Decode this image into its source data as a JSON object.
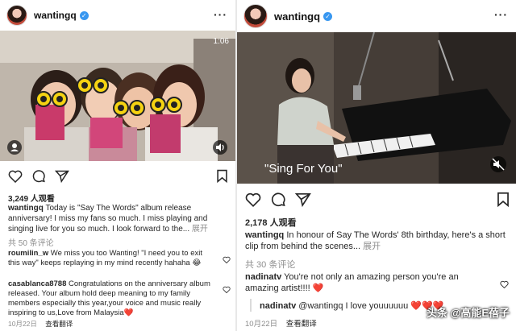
{
  "left": {
    "username": "wantingq",
    "video_time": "1:06",
    "views": "3,249 人观看",
    "caption_user": "wantingq",
    "caption_text": "Today is \"Say The Words\" album release anniversary! I miss my fans so much. I miss playing and singing live for you so much. I look forward to the...",
    "caption_more": "展开",
    "comments_total": "共 50 条评论",
    "comments": [
      {
        "user": "roumilin_w",
        "text": "We miss you too Wanting! \"I need you to exit this way\" keeps replaying in my mind recently hahaha 😂"
      },
      {
        "user": "casablanca8788",
        "text": "Congratulations on the anniversary album released. Your album hold deep meaning to my family members especially this year,your voice and music really inspiring to us,Love from Malaysia❤️"
      }
    ],
    "date": "10月22日",
    "translate": "查看翻译"
  },
  "right": {
    "username": "wantingq",
    "subtitle": "\"Sing For You\"",
    "views": "2,178 人观看",
    "caption_user": "wantingq",
    "caption_text": "In honour of Say The Words' 8th birthday, here's a short clip from behind the scenes...",
    "caption_more": "展开",
    "comments_total": "共 30 条评论",
    "comments": [
      {
        "user": "nadinatv",
        "text": "You're not only an amazing person you're an amazing artist!!!! ❤️"
      },
      {
        "user": "nadinatv",
        "text": "@wantingq I love youuuuuu ❤️❤️❤️"
      }
    ],
    "date": "10月22日",
    "translate": "查看翻译"
  },
  "watermark": "头条 @高能E蓓子",
  "colors": {
    "accent": "#3897f0",
    "heart": "#ed4956",
    "muted": "#8e8e8e"
  }
}
